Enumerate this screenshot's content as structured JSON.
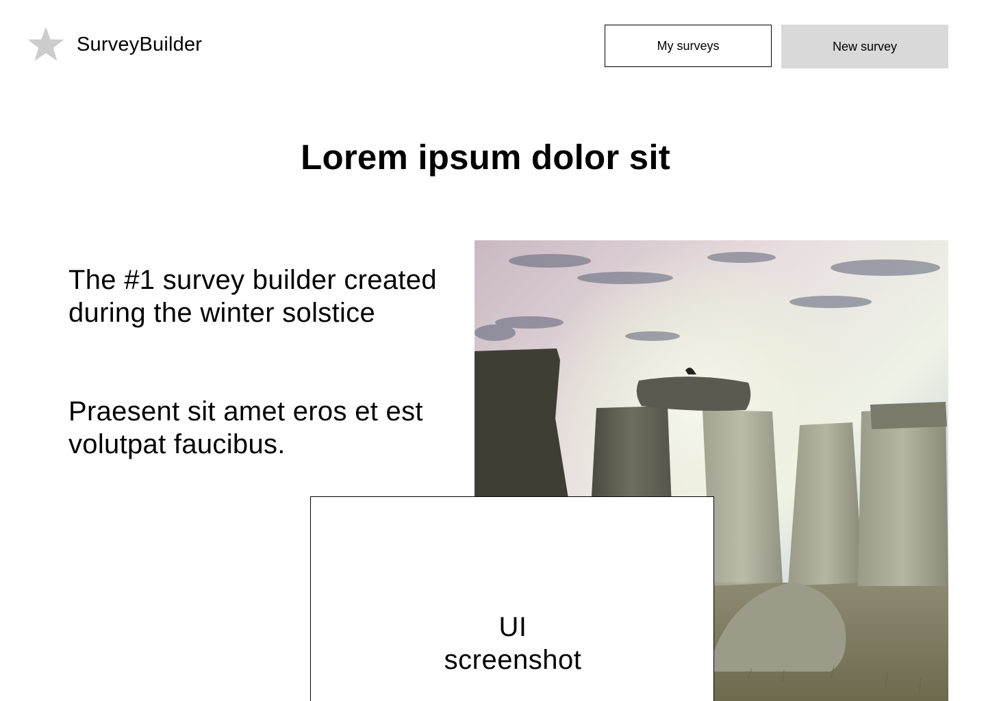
{
  "header": {
    "brand_name": "SurveyBuilder",
    "logo_icon": "star-icon",
    "logo_color": "#cccccc",
    "nav": {
      "my_surveys_label": "My surveys",
      "new_survey_label": "New survey"
    },
    "new_survey_bg": "#d9d9d9"
  },
  "hero": {
    "title": "Lorem ipsum dolor sit"
  },
  "content": {
    "lead_1": "The #1 survey builder created during the winter solstice",
    "lead_2": "Praesent sit amet eros et est volutpat faucibus."
  },
  "image": {
    "subject": "stonehenge-photo"
  },
  "placeholder": {
    "label": "UI\nscreenshot"
  }
}
